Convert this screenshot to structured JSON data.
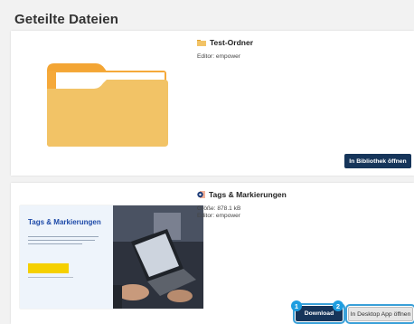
{
  "page": {
    "title": "Geteilte Dateien"
  },
  "files": [
    {
      "icon": "folder-icon",
      "name": "Test-Ordner",
      "meta": [
        "Editor: empower"
      ],
      "buttons": [
        "In Bibliothek öffnen"
      ]
    },
    {
      "icon": "powerpoint-icon",
      "name": "Tags & Markierungen",
      "meta": [
        "Größe: 878.1 kB",
        "Editor: empower"
      ],
      "preview_title": "Tags & Markierungen",
      "buttons": [
        "Download",
        "In Desktop App öffnen"
      ]
    }
  ],
  "step_markers": [
    "1",
    "2"
  ],
  "colors": {
    "accent": "#16355a",
    "highlight": "#3aa0d8",
    "marker": "#1e9ee0",
    "folder": "#f2c366"
  }
}
